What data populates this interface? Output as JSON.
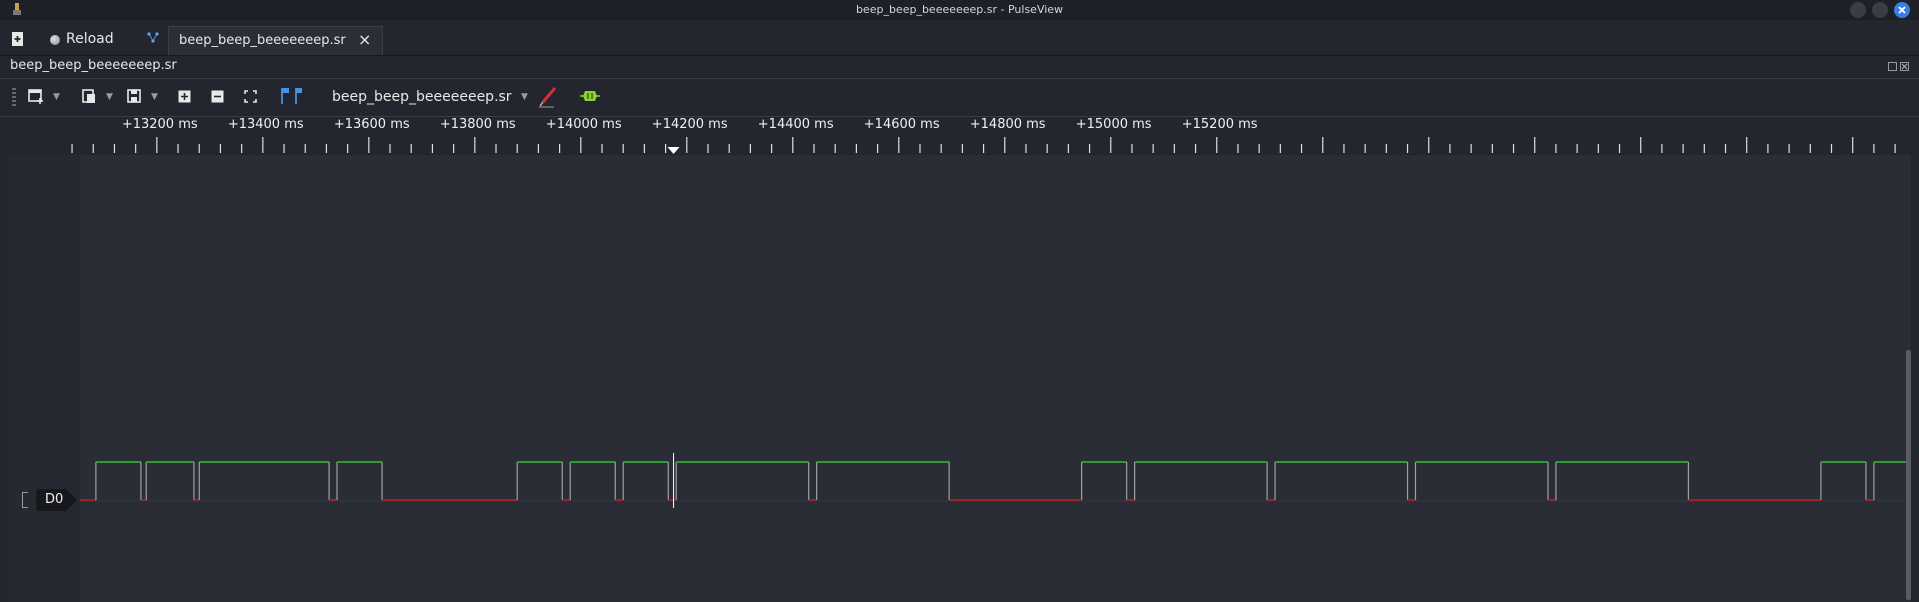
{
  "window": {
    "title": "beep_beep_beeeeeeep.sr - PulseView"
  },
  "tabs": {
    "reload_label": "Reload",
    "active_tab": {
      "label": "beep_beep_beeeeeeep.sr",
      "close": "×"
    }
  },
  "document": {
    "title": "beep_beep_beeeeeeep.sr"
  },
  "toolbar": {
    "device_name": "beep_beep_beeeeeeep.sr"
  },
  "ruler": {
    "ticks": [
      "+13200 ms",
      "+13400 ms",
      "+13600 ms",
      "+13800 ms",
      "+14000 ms",
      "+14200 ms",
      "+14400 ms",
      "+14600 ms",
      "+14800 ms",
      "+15000 ms",
      "+15200 ms"
    ]
  },
  "channel": {
    "name": "D0",
    "high_color": "#2ec02e",
    "low_color": "#c02020",
    "edge_color": "#a0a0a0",
    "transitions": [
      {
        "t": 13055,
        "level": 0
      },
      {
        "t": 13085,
        "level": 1
      },
      {
        "t": 13170,
        "level": 0
      },
      {
        "t": 13180,
        "level": 1
      },
      {
        "t": 13270,
        "level": 0
      },
      {
        "t": 13280,
        "level": 1
      },
      {
        "t": 13525,
        "level": 0
      },
      {
        "t": 13540,
        "level": 1
      },
      {
        "t": 13625,
        "level": 0
      },
      {
        "t": 13880,
        "level": 1
      },
      {
        "t": 13965,
        "level": 0
      },
      {
        "t": 13980,
        "level": 1
      },
      {
        "t": 14065,
        "level": 0
      },
      {
        "t": 14080,
        "level": 1
      },
      {
        "t": 14165,
        "level": 0
      },
      {
        "t": 14180,
        "level": 1
      },
      {
        "t": 14430,
        "level": 0
      },
      {
        "t": 14445,
        "level": 1
      },
      {
        "t": 14695,
        "level": 0
      },
      {
        "t": 14945,
        "level": 1
      },
      {
        "t": 15030,
        "level": 0
      },
      {
        "t": 15045,
        "level": 1
      },
      {
        "t": 15295,
        "level": 0
      },
      {
        "t": 15310,
        "level": 1
      },
      {
        "t": 15560,
        "level": 0
      },
      {
        "t": 15575,
        "level": 1
      },
      {
        "t": 15825,
        "level": 0
      },
      {
        "t": 15840,
        "level": 1
      },
      {
        "t": 16090,
        "level": 0
      },
      {
        "t": 16340,
        "level": 1
      },
      {
        "t": 16425,
        "level": 0
      },
      {
        "t": 16440,
        "level": 1
      },
      {
        "t": 16510,
        "level": 1
      }
    ],
    "cursor_t": 14175
  },
  "axis": {
    "t_min": 13055,
    "t_max": 16510
  }
}
